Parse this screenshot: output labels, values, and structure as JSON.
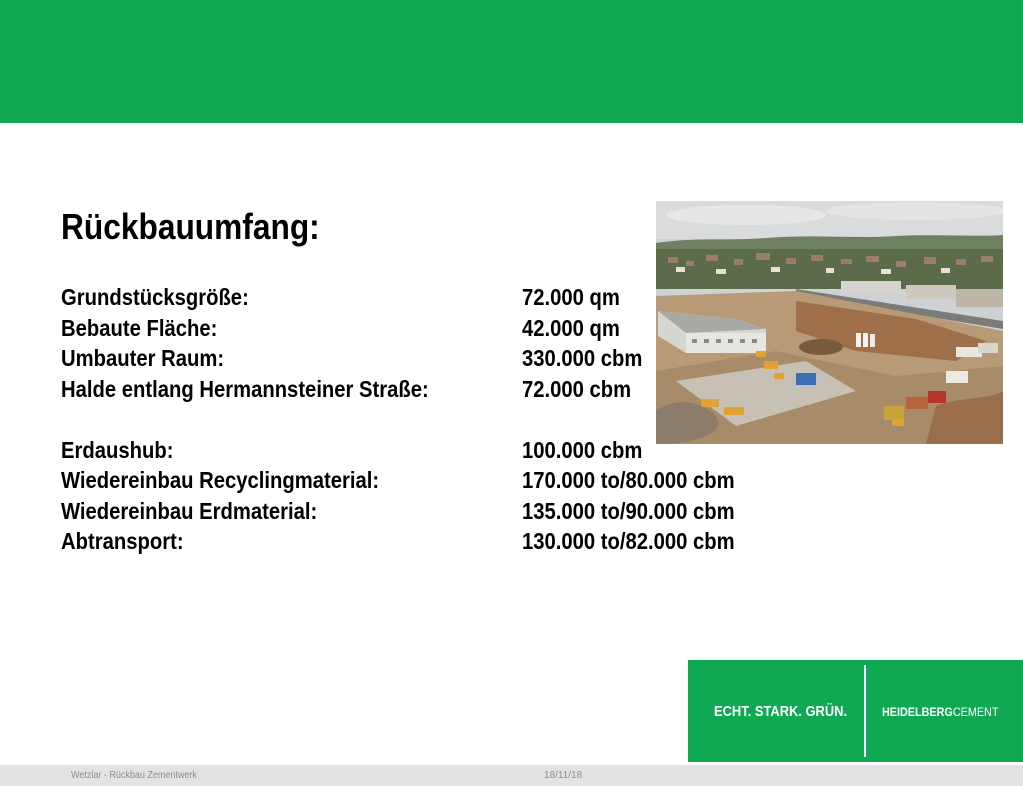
{
  "slide": {
    "title": "Rückbauumfang:",
    "facts_group1": [
      {
        "label": "Grundstücksgröße:",
        "value": "72.000 qm"
      },
      {
        "label": "Bebaute Fläche:",
        "value": "42.000 qm"
      },
      {
        "label": "Umbauter Raum:",
        "value": "330.000 cbm"
      },
      {
        "label": "Halde entlang Hermannsteiner Straße:",
        "value": "72.000 cbm"
      }
    ],
    "facts_group2": [
      {
        "label": "Erdaushub:",
        "value": "100.000 cbm"
      },
      {
        "label": "Wiedereinbau Recyclingmaterial:",
        "value": "170.000 to/80.000 cbm"
      },
      {
        "label": "Wiedereinbau Erdmaterial:",
        "value": "135.000 to/90.000 cbm"
      },
      {
        "label": "Abtransport:",
        "value": "130.000 to/82.000 cbm"
      }
    ]
  },
  "branding": {
    "claim": "ECHT. STARK. GRÜN.",
    "logo_strong": "HEIDELBERG",
    "logo_light": "CEMENT",
    "color": "#0fa954"
  },
  "footer": {
    "left": "Wetzlar - Rückbau Zementwerk",
    "date": "18/11/18"
  }
}
